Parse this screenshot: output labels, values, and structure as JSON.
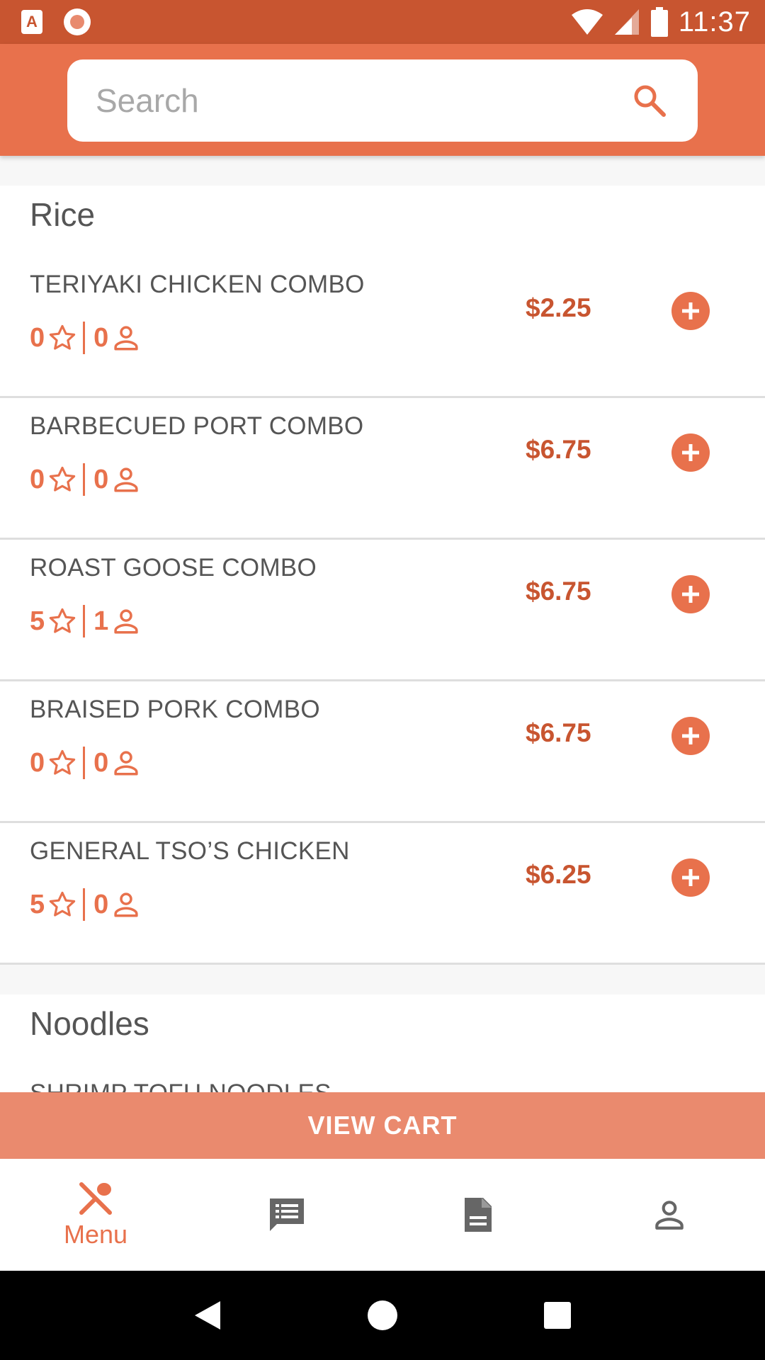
{
  "status_bar": {
    "app_icon_letter": "A",
    "time": "11:37"
  },
  "search": {
    "placeholder": "Search"
  },
  "categories": [
    {
      "title": "Rice",
      "items": [
        {
          "name": "TERIYAKI CHICKEN COMBO",
          "rating": "0",
          "reviews": "0",
          "price": "$2.25"
        },
        {
          "name": "BARBECUED PORT COMBO",
          "rating": "0",
          "reviews": "0",
          "price": "$6.75"
        },
        {
          "name": "ROAST GOOSE COMBO",
          "rating": "5",
          "reviews": "1",
          "price": "$6.75"
        },
        {
          "name": "BRAISED PORK COMBO",
          "rating": "0",
          "reviews": "0",
          "price": "$6.75"
        },
        {
          "name": "GENERAL TSO’S CHICKEN",
          "rating": "5",
          "reviews": "0",
          "price": "$6.25"
        }
      ]
    },
    {
      "title": "Noodles",
      "items": [
        {
          "name": "SHRIMP TOFU NOODLES",
          "rating": "",
          "reviews": "",
          "price": ""
        }
      ]
    }
  ],
  "cart": {
    "label": "VIEW CART"
  },
  "bottom_nav": {
    "menu_label": "Menu"
  },
  "colors": {
    "status_bar": "#c85530",
    "header": "#e8714c",
    "accent": "#e8714c",
    "price": "#c85530",
    "view_cart": "#ea8a6e",
    "nav_inactive": "#666666"
  },
  "icons": {
    "search": "search-icon",
    "rating": "star-icon",
    "reviews": "person-icon",
    "add": "plus-circle-icon",
    "nav": [
      "utensils-icon",
      "chat-icon",
      "document-icon",
      "account-icon"
    ]
  }
}
